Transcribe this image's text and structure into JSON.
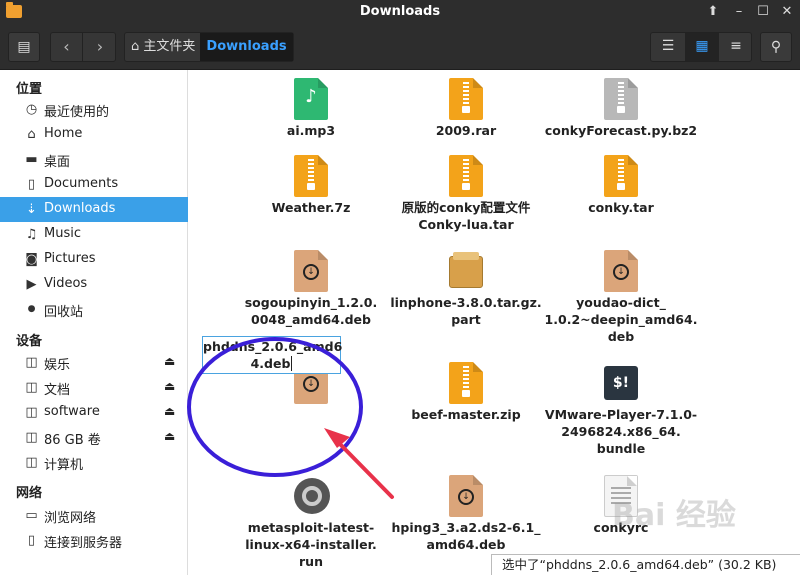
{
  "window": {
    "title": "Downloads"
  },
  "toolbar": {
    "breadcrumb": [
      {
        "label": "主文件夹",
        "icon": "home-icon"
      },
      {
        "label": "Downloads",
        "active": true
      }
    ],
    "view_modes": [
      "list-view-icon",
      "grid-view-icon",
      "compact-view-icon"
    ],
    "active_view": "grid-view-icon"
  },
  "sidebar": {
    "places_header": "位置",
    "places": [
      {
        "label": "最近使用的",
        "icon": "clock-icon"
      },
      {
        "label": "Home",
        "icon": "home-icon"
      },
      {
        "label": "桌面",
        "icon": "folder-icon"
      },
      {
        "label": "Documents",
        "icon": "document-icon"
      },
      {
        "label": "Downloads",
        "icon": "download-icon",
        "selected": true
      },
      {
        "label": "Music",
        "icon": "music-icon"
      },
      {
        "label": "Pictures",
        "icon": "camera-icon"
      },
      {
        "label": "Videos",
        "icon": "video-icon"
      },
      {
        "label": "回收站",
        "icon": "trash-icon"
      }
    ],
    "devices_header": "设备",
    "devices": [
      {
        "label": "娱乐",
        "icon": "drive-icon",
        "eject": true
      },
      {
        "label": "文档",
        "icon": "drive-icon",
        "eject": true
      },
      {
        "label": "software",
        "icon": "drive-icon",
        "eject": true
      },
      {
        "label": "86 GB 卷",
        "icon": "drive-icon",
        "eject": true
      },
      {
        "label": "计算机",
        "icon": "drive-icon",
        "eject": false
      }
    ],
    "network_header": "网络",
    "network": [
      {
        "label": "浏览网络",
        "icon": "network-icon"
      },
      {
        "label": "连接到服务器",
        "icon": "server-icon"
      }
    ]
  },
  "files": [
    {
      "name_lines": [
        "ai.mp3"
      ],
      "type": "audio",
      "color": "#2eb872"
    },
    {
      "name_lines": [
        "2009.rar"
      ],
      "type": "archive",
      "color": "#f3a31a"
    },
    {
      "name_lines": [
        "conkyForecast.py.bz2"
      ],
      "type": "archive",
      "color": "#b8b8b8"
    },
    {
      "name_lines": [
        "Weather.7z"
      ],
      "type": "archive",
      "color": "#f3a31a"
    },
    {
      "name_lines": [
        "原版的conky配置文件",
        "Conky-lua.tar"
      ],
      "type": "archive",
      "color": "#f3a31a"
    },
    {
      "name_lines": [
        "conky.tar"
      ],
      "type": "archive",
      "color": "#f3a31a"
    },
    {
      "name_lines": [
        "sogoupinyin_1.2.0.",
        "0048_amd64.deb"
      ],
      "type": "deb",
      "color": "#dba57a"
    },
    {
      "name_lines": [
        "linphone-3.8.0.tar.gz.",
        "part"
      ],
      "type": "package",
      "color": "#d8a04a"
    },
    {
      "name_lines": [
        "youdao-dict_",
        "1.0.2~deepin_amd64.",
        "deb"
      ],
      "type": "deb",
      "color": "#dba57a"
    },
    {
      "name_lines": [
        "phddns_2.0.6_amd6",
        "4.deb"
      ],
      "type": "deb",
      "color": "#dba57a",
      "renaming": true
    },
    {
      "name_lines": [
        "beef-master.zip"
      ],
      "type": "archive",
      "color": "#f3a31a"
    },
    {
      "name_lines": [
        "VMware-Player-7.1.0-",
        "2496824.x86_64.",
        "bundle"
      ],
      "type": "script",
      "color": "#2a3540"
    },
    {
      "name_lines": [
        "metasploit-latest-",
        "linux-x64-installer.",
        "run"
      ],
      "type": "executable",
      "color": "#555555"
    },
    {
      "name_lines": [
        "hping3_3.a2.ds2-6.1_",
        "amd64.deb"
      ],
      "type": "deb",
      "color": "#dba57a"
    },
    {
      "name_lines": [
        "conkyrc"
      ],
      "type": "text",
      "color": "#aaaaaa"
    }
  ],
  "status": "选中了“phddns_2.0.6_amd64.deb” (30.2 KB)",
  "annotation": {
    "circle_color": "#3a1fd8",
    "arrow_color": "#e8324a"
  }
}
